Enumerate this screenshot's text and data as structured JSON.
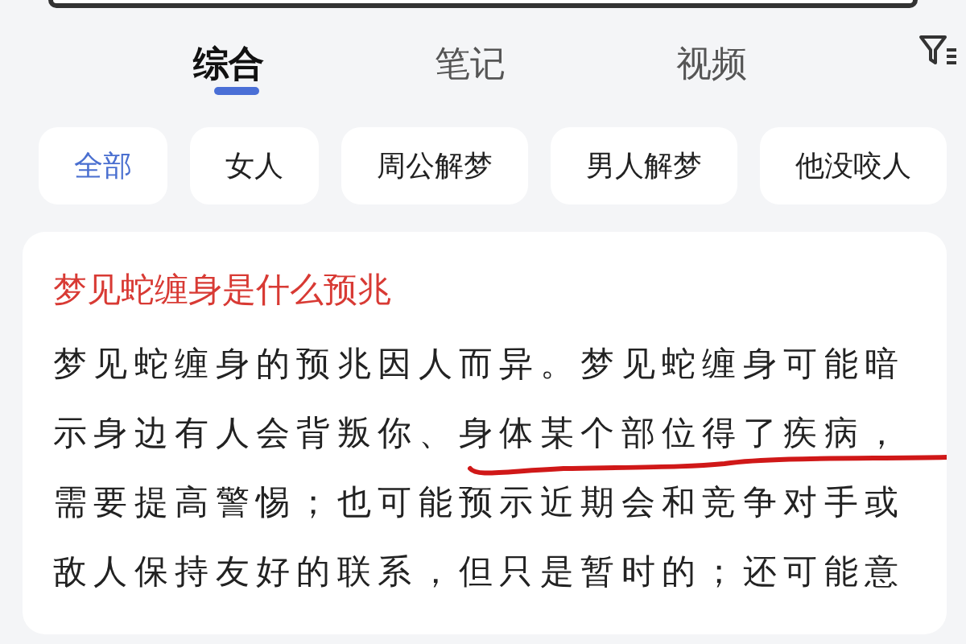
{
  "tabs": [
    {
      "label": "综合",
      "selected": true
    },
    {
      "label": "笔记",
      "selected": false
    },
    {
      "label": "视频",
      "selected": false
    }
  ],
  "chips": [
    {
      "label": "全部",
      "selected": true
    },
    {
      "label": "女人",
      "selected": false
    },
    {
      "label": "周公解梦",
      "selected": false
    },
    {
      "label": "男人解梦",
      "selected": false
    },
    {
      "label": "他没咬人",
      "selected": false
    }
  ],
  "result": {
    "title": "梦见蛇缠身是什么预兆",
    "snippet_lines": [
      "梦见蛇缠身的预兆因人而异。梦见蛇缠身可能暗",
      "示身边有人会背叛你、身体某个部位得了疾病，",
      "需要提高警惕；也可能预示近期会和竞争对手或",
      "敌人保持友好的联系，但只是暂时的；还可能意"
    ]
  }
}
